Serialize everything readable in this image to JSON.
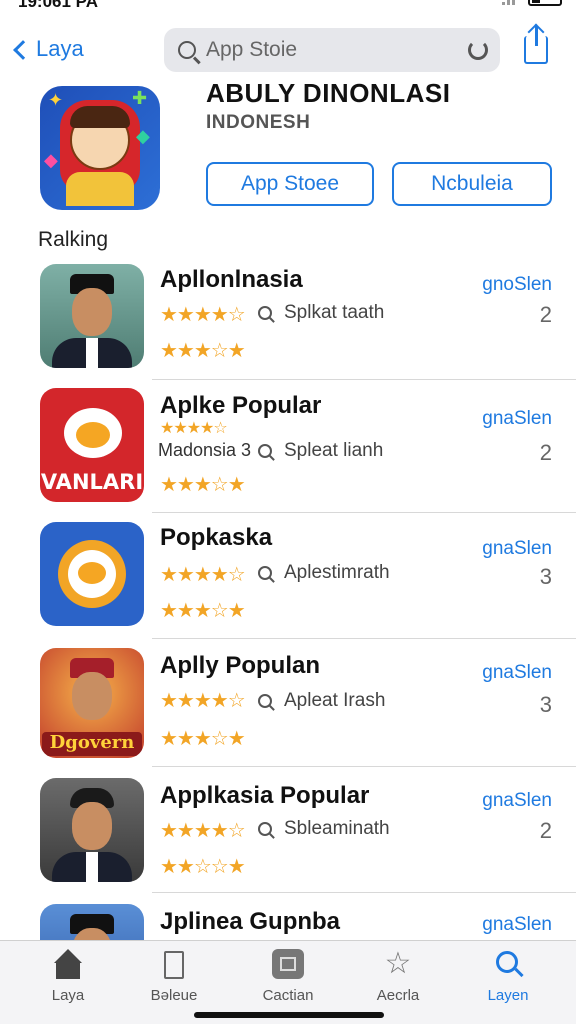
{
  "status": {
    "time": "19:061 PA",
    "battery_label": ""
  },
  "nav": {
    "back_label": "Laya",
    "search_placeholder": "App Stoie"
  },
  "hero": {
    "title": "ABULY DINONLASI",
    "subtitle": "INDONESH",
    "button_primary": "App Stoee",
    "button_secondary": "Ncbuleia"
  },
  "section": {
    "title": "Ralking"
  },
  "rows": [
    {
      "name": "Apllonlnasia",
      "meta": "Splkat taath",
      "get": "gnoSlen",
      "num": "2",
      "sub": ""
    },
    {
      "name": "Aplke Popular",
      "meta": "Splеat lianh",
      "get": "gnaSlen",
      "num": "2",
      "sub": "Madonsia  3",
      "icon_text": "VANLARI"
    },
    {
      "name": "Popkaska",
      "meta": "Aplestimrath",
      "get": "gnaSlen",
      "num": "3",
      "sub": ""
    },
    {
      "name": "Aplly Populan",
      "meta": "Apleаt Irash",
      "get": "gnaSlen",
      "num": "3",
      "sub": "",
      "icon_text": "Dgovern"
    },
    {
      "name": "Applkasia Popular",
      "meta": "Sbleaminath",
      "get": "gnaSlen",
      "num": "2",
      "sub": ""
    },
    {
      "name": "Jplinea Gupnba",
      "meta": "",
      "get": "gnaSlen",
      "num": "",
      "sub": ""
    }
  ],
  "ratings": {
    "row_stars": "★★★★☆",
    "row_stars_low": "★★★☆★",
    "row_stars_lower": "★★☆☆★"
  },
  "tabbar": {
    "tabs": [
      {
        "label": "Laya",
        "icon": "home-icon"
      },
      {
        "label": "Bəleue",
        "icon": "document-icon"
      },
      {
        "label": "Cactian",
        "icon": "apps-icon"
      },
      {
        "label": "Aecrla",
        "icon": "star-icon"
      },
      {
        "label": "Layen",
        "icon": "search-icon"
      }
    ],
    "active_index": 4
  },
  "colors": {
    "accent": "#1f7ae0",
    "star": "#f2a526"
  }
}
